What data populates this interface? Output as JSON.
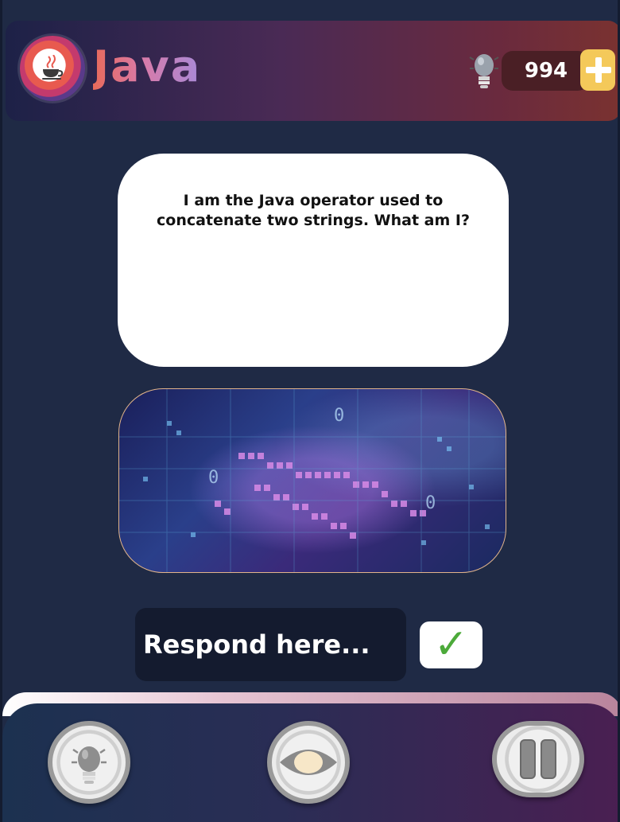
{
  "header": {
    "app_title": "Java",
    "coins": "994",
    "logo_icon": "java-cup-icon",
    "hint_icon": "lightbulb-icon",
    "add_icon": "plus-icon"
  },
  "question": {
    "text": "I am the Java operator used to concatenate two strings. What am I?"
  },
  "answer": {
    "placeholder": "Respond here...",
    "submit_icon": "checkmark-icon",
    "submit_symbol": "✓"
  },
  "footer": {
    "hint_icon": "lightbulb-icon",
    "reveal_icon": "eye-icon",
    "pause_icon": "pause-icon"
  },
  "colors": {
    "accent_yellow": "#f4c95a",
    "check_green": "#4caa3a",
    "background": "#1f2a45"
  }
}
